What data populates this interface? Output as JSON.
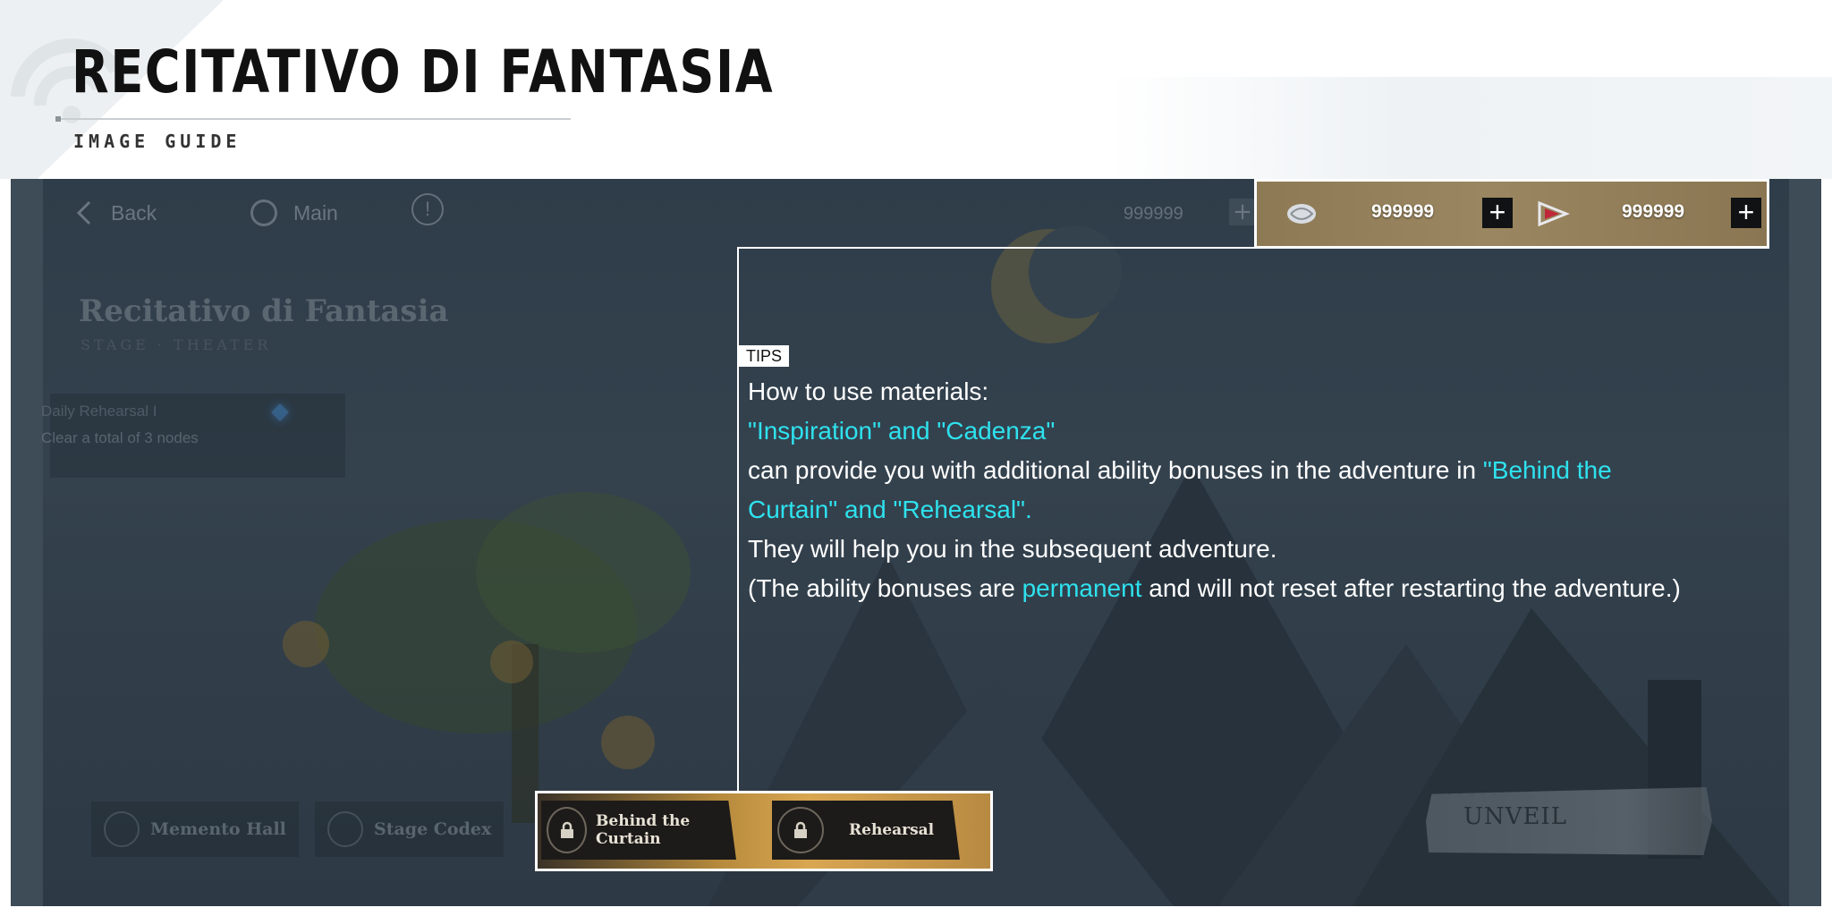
{
  "guide": {
    "title": "RECITATIVO DI FANTASIA",
    "subtitle": "IMAGE GUIDE"
  },
  "topbar": {
    "back_label": "Back",
    "main_label": "Main",
    "info_glyph": "!",
    "currency_dim_value": "999999",
    "plus_glyph": "+"
  },
  "stage": {
    "title": "Recitativo di Fantasia",
    "subtitle": "STAGE · THEATER"
  },
  "quest": {
    "title": "Daily Rehearsal I",
    "desc": "Clear a total of 3 nodes"
  },
  "currencies": [
    {
      "icon": "inspiration-icon",
      "value": "999999"
    },
    {
      "icon": "cadenza-icon",
      "value": "999999"
    }
  ],
  "tips": {
    "tag": "TIPS",
    "line1": "How to use materials:",
    "line2": "\"Inspiration\" and \"Cadenza\"",
    "line3a": "can provide you with additional ability bonuses in the adventure in ",
    "line3b": "\"Behind the",
    "line4": "Curtain\" and \"Rehearsal\".",
    "line5": "They will help you in the subsequent adventure.",
    "line6a": "(The ability bonuses are ",
    "line6b": "permanent",
    "line6c": " and will not reset after restarting the adventure.)"
  },
  "bottom": {
    "memento_label": "Memento Hall",
    "codex_label": "Stage Codex",
    "behind_label": "Behind the Curtain",
    "rehearsal_label": "Rehearsal",
    "unveil_label": "UNVEIL"
  },
  "colors": {
    "highlight": "#2ee2ee",
    "currency_bar": "#9a8660"
  }
}
